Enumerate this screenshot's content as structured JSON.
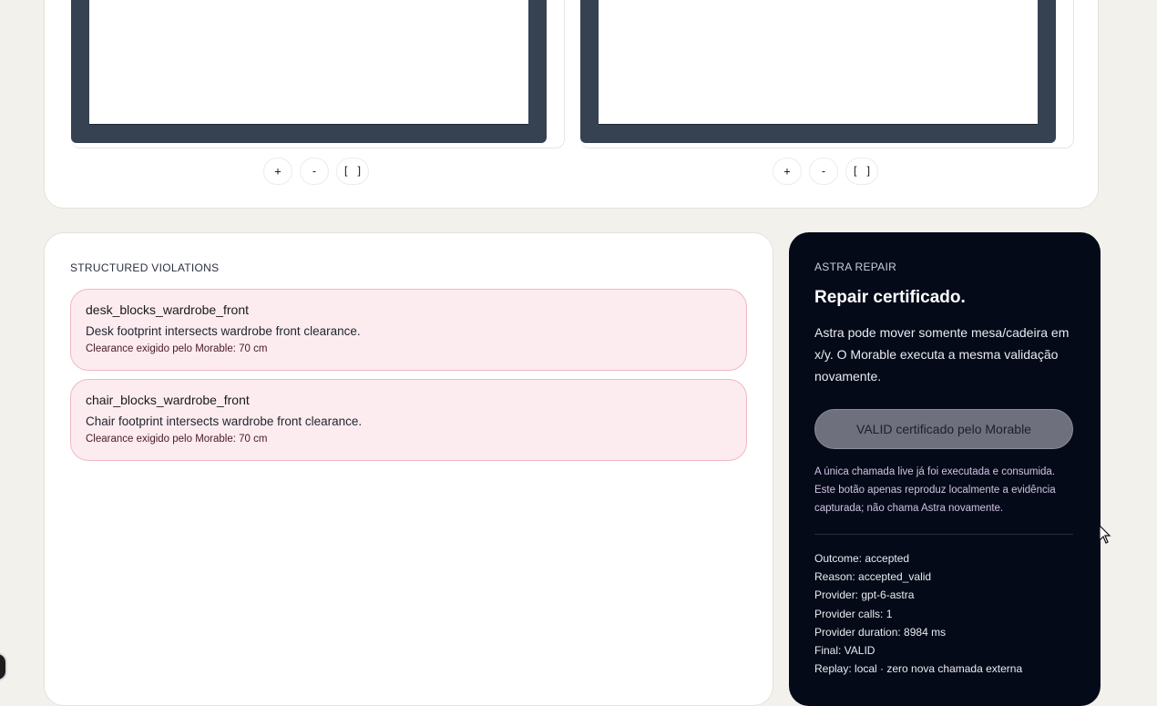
{
  "viewports": {
    "left": {
      "zoom_in": "+",
      "zoom_out": "-",
      "fit": "[ ]"
    },
    "right": {
      "zoom_in": "+",
      "zoom_out": "-",
      "fit": "[ ]"
    }
  },
  "violations": {
    "section_label": "STRUCTURED VIOLATIONS",
    "items": [
      {
        "code": "desk_blocks_wardrobe_front",
        "message": "Desk footprint intersects wardrobe front clearance.",
        "requirement": "Clearance exigido pelo Morable: 70 cm"
      },
      {
        "code": "chair_blocks_wardrobe_front",
        "message": "Chair footprint intersects wardrobe front clearance.",
        "requirement": "Clearance exigido pelo Morable: 70 cm"
      }
    ]
  },
  "repair": {
    "section_label": "ASTRA REPAIR",
    "title": "Repair certificado.",
    "description": "Astra pode mover somente mesa/cadeira em x/y. O Morable executa a mesma validação novamente.",
    "button_label": "VALID certificado pelo Morable",
    "note": "A única chamada live já foi executada e consumida. Este botão apenas reproduz localmente a evidência capturada; não chama Astra novamente.",
    "meta": [
      "Outcome: accepted",
      "Reason: accepted_valid",
      "Provider: gpt-6-astra",
      "Provider calls: 1",
      "Provider duration: 8984 ms",
      "Final: VALID",
      "Replay: local · zero nova chamada externa"
    ]
  },
  "colors": {
    "page_bg": "#f3f1ec",
    "viewport_frame": "#364152",
    "violation_bg": "#fcecef",
    "violation_border": "#f0b8c3",
    "repair_bg": "#050a18",
    "valid_button_bg": "#6e717d"
  }
}
